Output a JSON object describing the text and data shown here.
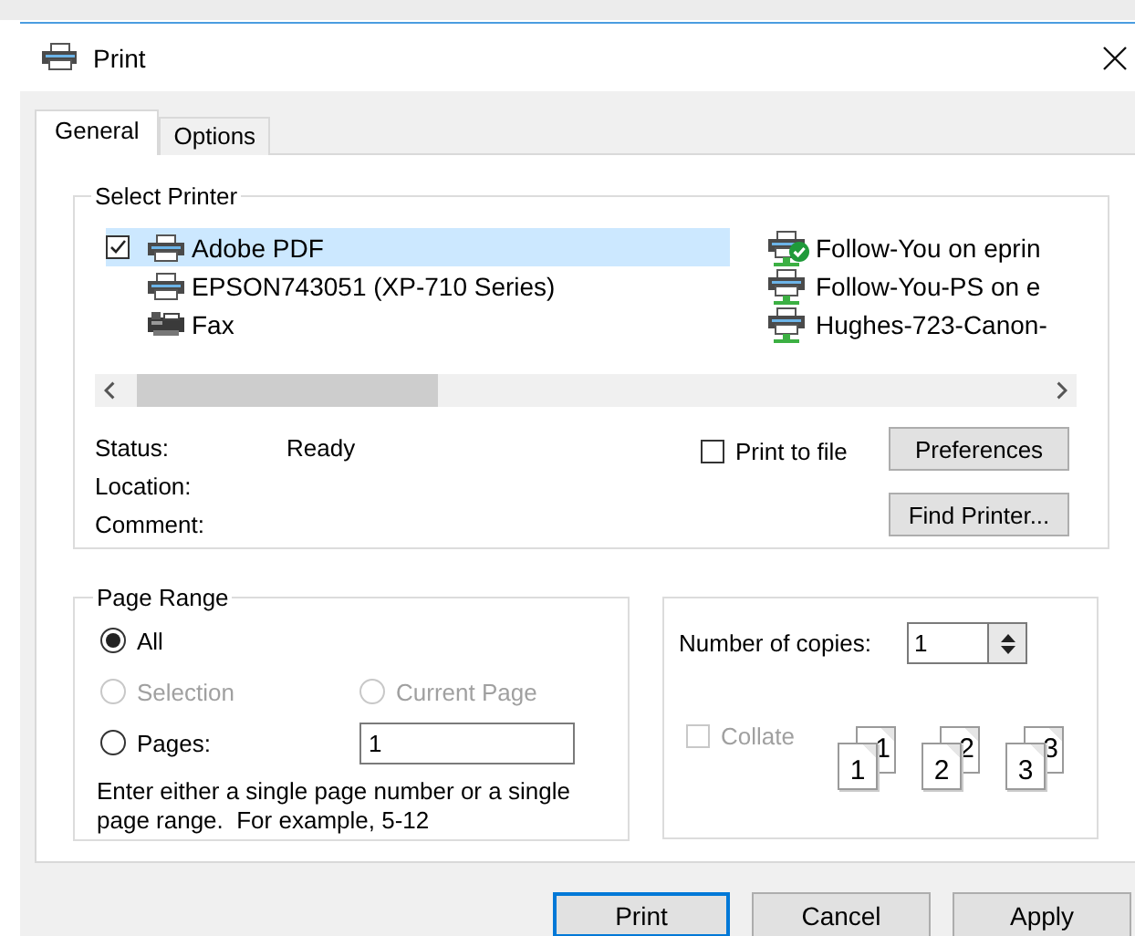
{
  "window": {
    "title": "Print"
  },
  "tabs": [
    {
      "label": "General",
      "selected": true
    },
    {
      "label": "Options",
      "selected": false
    }
  ],
  "select_printer": {
    "title": "Select Printer",
    "printers": [
      {
        "name": "Adobe PDF",
        "kind": "printer",
        "default": false,
        "selected": true
      },
      {
        "name": "EPSON743051 (XP-710 Series)",
        "kind": "printer",
        "default": false,
        "selected": false
      },
      {
        "name": "Fax",
        "kind": "fax",
        "default": false,
        "selected": false
      },
      {
        "name": "Follow-You on eprin",
        "kind": "network",
        "default": true,
        "selected": false
      },
      {
        "name": "Follow-You-PS on e",
        "kind": "network",
        "default": false,
        "selected": false
      },
      {
        "name": "Hughes-723-Canon-",
        "kind": "network",
        "default": false,
        "selected": false
      }
    ],
    "status_label": "Status:",
    "status": "Ready",
    "location_label": "Location:",
    "comment_label": "Comment:",
    "print_to_file": {
      "label": "Print to file",
      "checked": false
    },
    "preferences": "Preferences",
    "find_printer": "Find Printer..."
  },
  "page_range": {
    "title": "Page Range",
    "options": [
      {
        "label": "All",
        "selected": true,
        "disabled": false
      },
      {
        "label": "Selection",
        "selected": false,
        "disabled": true
      },
      {
        "label": "Current Page",
        "selected": false,
        "disabled": true
      },
      {
        "label": "Pages:",
        "selected": false,
        "disabled": false
      }
    ],
    "pages_value": "1",
    "hint": "Enter either a single page number or a single page range.  For example, 5-12"
  },
  "copies": {
    "label": "Number of copies:",
    "value": "1",
    "collate": {
      "label": "Collate",
      "checked": false,
      "disabled": true
    },
    "collate_pages": [
      [
        "1",
        "1"
      ],
      [
        "2",
        "2"
      ],
      [
        "3",
        "3"
      ]
    ]
  },
  "buttons": [
    {
      "label": "Print",
      "default": true
    },
    {
      "label": "Cancel",
      "default": false
    },
    {
      "label": "Apply",
      "default": false
    }
  ]
}
